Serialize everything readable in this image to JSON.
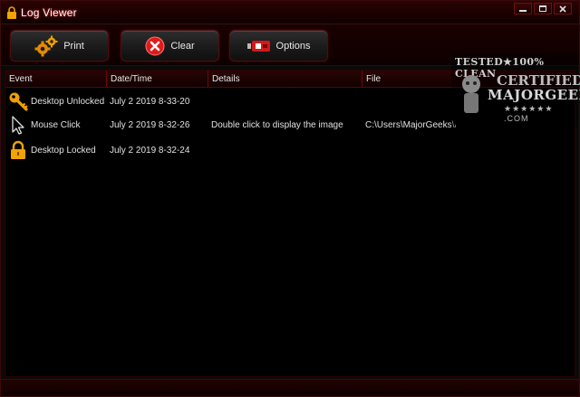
{
  "window": {
    "title": "Log Viewer"
  },
  "toolbar": {
    "print_label": "Print",
    "clear_label": "Clear",
    "options_label": "Options"
  },
  "columns": [
    "Event",
    "Date/Time",
    "Details",
    "File"
  ],
  "rows": [
    {
      "icon": "key-icon",
      "event": "Desktop Unlocked",
      "datetime": "July 2 2019  8-33-20",
      "details": "",
      "file": ""
    },
    {
      "icon": "cursor-icon",
      "event": "Mouse Click",
      "datetime": "July 2 2019  8-32-26",
      "details": "Double click to display the image",
      "file": "C:\\Users\\MajorGeeks\\A..."
    },
    {
      "icon": "lock-icon",
      "event": "Desktop Locked",
      "datetime": "July 2 2019  8-32-24",
      "details": "",
      "file": ""
    }
  ],
  "watermark": {
    "line1": "TESTED★100% CLEAN",
    "line2": "CERTIFIED",
    "line3": "MAJORGEEKS",
    "line4": "★★★★★★ .COM"
  },
  "colors": {
    "accent": "#cc1111",
    "background": "#000000",
    "header": "#2a0505"
  }
}
